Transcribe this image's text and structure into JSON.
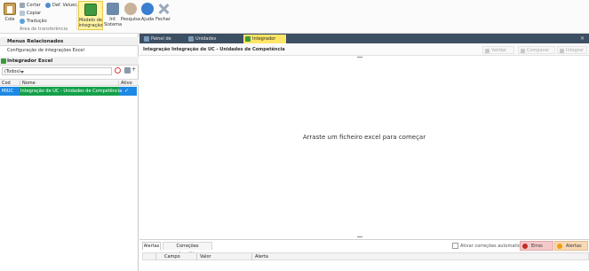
{
  "ribbon": {
    "cole": "Cole",
    "cortar": "Cortar",
    "copiar": "Copiar",
    "traducao": "Tradução",
    "def_values": "Def. Values...",
    "group_label": "Área de transferência",
    "modelo": "Modelo de\nintegração",
    "inf_sistema": "Inf.\nSistema",
    "pesquisa": "Pesquisa",
    "ajuda": "Ajuda",
    "fechar": "Fechar"
  },
  "left": {
    "menus_title": "Menus Relacionados",
    "menus_item": "Configuração de integrações Excel",
    "integrador_title": "Integrador Excel",
    "filter_value": "(Todos)",
    "columns": [
      "Cod",
      "Nome",
      "Ativo"
    ],
    "rows": [
      {
        "cod": "MIUC",
        "nome": "Integração de UC - Unidades de Competência",
        "ativo": "✓"
      }
    ]
  },
  "tabs": [
    {
      "label": "Painel de Bordo",
      "active": false,
      "icon_color": "#7a9ab8"
    },
    {
      "label": "Unidades Competência",
      "active": false,
      "icon_color": "#7a9ab8"
    },
    {
      "label": "Integrador Excel",
      "active": true,
      "icon_color": "#3a9a3a"
    }
  ],
  "content": {
    "title": "Integração Integração de UC - Unidades de Competência",
    "validar": "Validar",
    "comparar": "Comparar",
    "integrar": "Integrar",
    "drop_text": "Arraste um ficheiro excel para começar"
  },
  "bottom": {
    "tab_alertas": "Alertas",
    "tab_correcoes": "Correções automáticas",
    "ativar_label": "Ativar correções automaticas",
    "erros_label": "Erros",
    "alertas_label": "Alertas",
    "columns": [
      "Campo",
      "Valor",
      "Alerta"
    ]
  }
}
